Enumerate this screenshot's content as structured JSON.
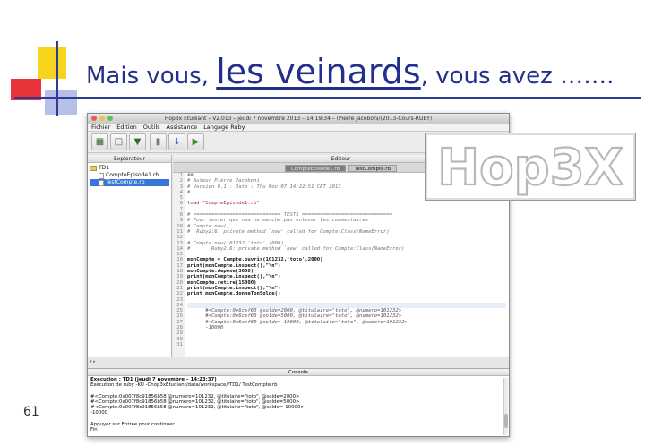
{
  "slide": {
    "title_pre": "Mais vous, ",
    "title_big": "les veinards",
    "title_post": ", vous avez …….",
    "number": "61"
  },
  "window": {
    "title": "Hop3x Etudiant – V2.013 – jeudi 7 novembre 2013 – 14:19:34  –  (Pierre Jacoboni/(2013-Cours-RUBY)",
    "menu": [
      "Fichier",
      "Edition",
      "Outils",
      "Assistance",
      "Langage Ruby"
    ]
  },
  "explorer": {
    "title": "Explorateur",
    "root": "TD1",
    "files": [
      "CompteEpisode1.rb",
      "TestCompte.rb"
    ],
    "selected": "TestCompte.rb"
  },
  "editor": {
    "title": "Editeur",
    "tabs": [
      "CompteEpisode1.rb",
      "TestCompte.rb"
    ],
    "line_numbers": [
      "1",
      "2",
      "3",
      "4",
      "5",
      "6",
      "7",
      "8",
      "9",
      "10",
      "11",
      "12",
      "13",
      "14",
      "15",
      "16",
      "17",
      "18",
      "19",
      "20",
      "21",
      "22",
      "23",
      "24",
      "25",
      "26",
      "27",
      "28",
      "29",
      "30",
      "31"
    ],
    "lines": [
      "##",
      "# Auteur Pierre Jacoboni",
      "# Version 0.1 : Date : Thu Nov 07 14:22:51 CET 2013",
      "#",
      "",
      "load \"CompteEpisode1.rb\"",
      "",
      "# ============================= TESTS ==============================",
      "# Pour tester que new ne marche pas enlever les commentaires",
      "# Compte.new()",
      "#  Ruby2:6: private method `new' called for Compte:Class(NameError)",
      "",
      "# Compte.new(101232,'toto',2000)",
      "#       Ruby2:6: private method `new' called for Compte:Class(NameError)",
      "",
      "monCompte = Compte.ouvrir(101232,'toto',2000)",
      "print(monCompte.inspect(),\"\\n\")",
      "monCompte.depose(3000)",
      "print(monCompte.inspect(),\"\\n\")",
      "monCompte.retire(15000)",
      "print(monCompte.inspect(),\"\\n\")",
      "print monCompte.donneTonSolde()",
      "",
      "",
      "      #<Compte:0x6cef60 @solde=2000, @titulaire=\"toto\", @numero=101232>",
      "      #<Compte:0x6cef60 @solde=5000, @titulaire=\"toto\", @numero=101232>",
      "      #<Compte:0x6cef60 @solde=-10000, @titulaire=\"toto\", @numero=101232>",
      "      -10000",
      "",
      "",
      ""
    ]
  },
  "console": {
    "title": "Console",
    "lines": [
      "Exécution : TD1 (jeudi 7 novembre – 14:23:37)",
      "Exécution de ruby -KU -Chop3xEtudiant/data/workspace//TD1/ TestCompte.rb",
      "",
      "#<Compte:0x007f8c91856b58 @numero=101232, @titulaire=\"toto\", @solde=2000>",
      "#<Compte:0x007f8c91856b58 @numero=101232, @titulaire=\"toto\", @solde=5000>",
      "#<Compte:0x007f8c91856b58 @numero=101232, @titulaire=\"toto\", @solde=-10000>",
      "-10000",
      "",
      "Appuyer sur Entrée pour continuer ...",
      "Fin"
    ]
  },
  "logo": {
    "text": "Hop3X"
  },
  "colors": {
    "title_blue": "#22308c",
    "accent_yellow": "#f7d51c",
    "accent_red": "#e8343a",
    "accent_lavender": "#a9b4e4"
  }
}
